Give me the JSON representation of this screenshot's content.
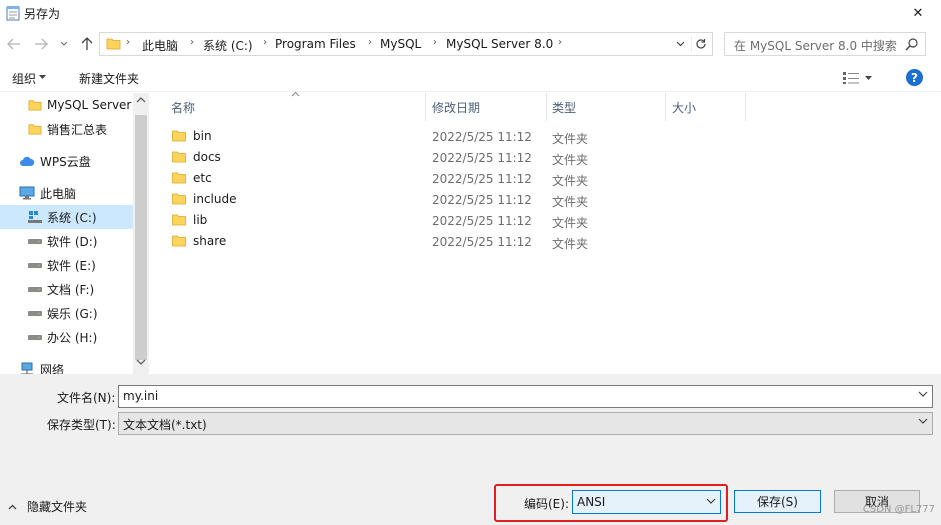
{
  "window": {
    "title": "另存为",
    "close_glyph": "✕"
  },
  "address": {
    "crumbs": [
      "此电脑",
      "系统 (C:)",
      "Program Files",
      "MySQL",
      "MySQL Server 8.0"
    ],
    "search_placeholder": "在 MySQL Server 8.0 中搜索"
  },
  "toolbar": {
    "organize": "组织",
    "new_folder": "新建文件夹",
    "help": "?"
  },
  "nav": {
    "items": [
      {
        "label": "MySQL Server",
        "icon": "folder-icon"
      },
      {
        "label": "销售汇总表",
        "icon": "folder-icon"
      },
      {
        "label": "WPS云盘",
        "icon": "cloud-icon"
      },
      {
        "label": "此电脑",
        "icon": "computer-icon"
      },
      {
        "label": "系统 (C:)",
        "icon": "windows-drive-icon",
        "selected": true
      },
      {
        "label": "软件 (D:)",
        "icon": "drive-icon"
      },
      {
        "label": "软件 (E:)",
        "icon": "drive-icon"
      },
      {
        "label": "文档 (F:)",
        "icon": "drive-icon"
      },
      {
        "label": "娱乐 (G:)",
        "icon": "drive-icon"
      },
      {
        "label": "办公 (H:)",
        "icon": "drive-icon"
      },
      {
        "label": "网络",
        "icon": "network-icon"
      }
    ]
  },
  "files": {
    "columns": [
      "名称",
      "修改日期",
      "类型",
      "大小"
    ],
    "rows": [
      {
        "name": "bin",
        "date": "2022/5/25 11:12",
        "type": "文件夹"
      },
      {
        "name": "docs",
        "date": "2022/5/25 11:12",
        "type": "文件夹"
      },
      {
        "name": "etc",
        "date": "2022/5/25 11:12",
        "type": "文件夹"
      },
      {
        "name": "include",
        "date": "2022/5/25 11:12",
        "type": "文件夹"
      },
      {
        "name": "lib",
        "date": "2022/5/25 11:12",
        "type": "文件夹"
      },
      {
        "name": "share",
        "date": "2022/5/25 11:12",
        "type": "文件夹"
      }
    ]
  },
  "form": {
    "filename_label": "文件名(N):",
    "filename_value": "my.ini",
    "filetype_label": "保存类型(T):",
    "filetype_value": "文本文档(*.txt)",
    "hide_folders": "隐藏文件夹",
    "encoding_label": "编码(E):",
    "encoding_value": "ANSI",
    "save_label": "保存(S)",
    "cancel_label": "取消"
  },
  "watermark": "CSDN @FL777",
  "colors": {
    "accent": "#0078d7",
    "highlight": "#e02020",
    "folder": "#ffd35c"
  }
}
